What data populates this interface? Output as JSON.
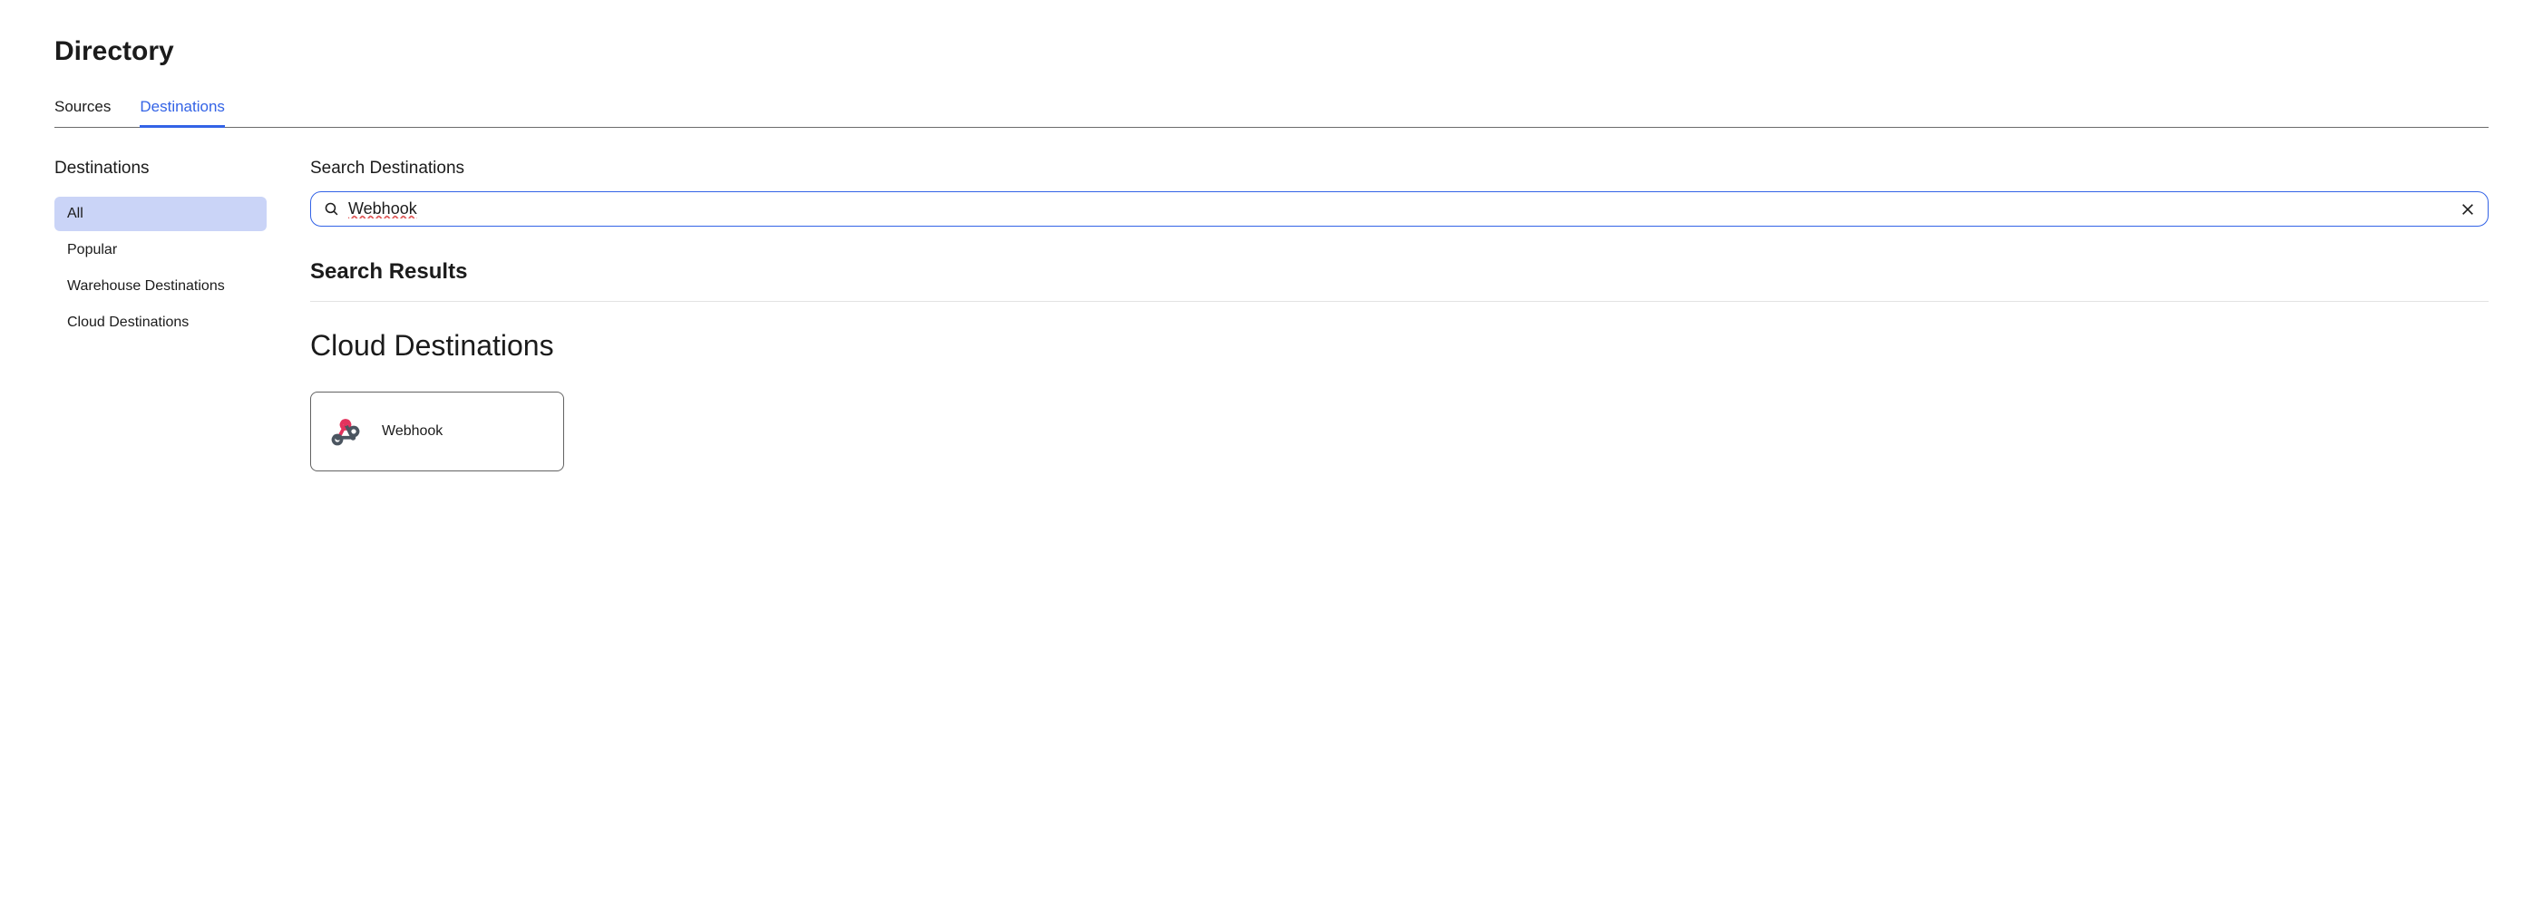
{
  "page": {
    "title": "Directory"
  },
  "tabs": [
    {
      "label": "Sources",
      "active": false
    },
    {
      "label": "Destinations",
      "active": true
    }
  ],
  "sidebar": {
    "title": "Destinations",
    "items": [
      {
        "label": "All",
        "selected": true
      },
      {
        "label": "Popular",
        "selected": false
      },
      {
        "label": "Warehouse Destinations",
        "selected": false
      },
      {
        "label": "Cloud Destinations",
        "selected": false
      }
    ]
  },
  "search": {
    "label": "Search Destinations",
    "value": "Webhook",
    "placeholder": ""
  },
  "results": {
    "heading": "Search Results",
    "group_heading": "Cloud Destinations",
    "items": [
      {
        "label": "Webhook",
        "icon": "webhook"
      }
    ]
  }
}
